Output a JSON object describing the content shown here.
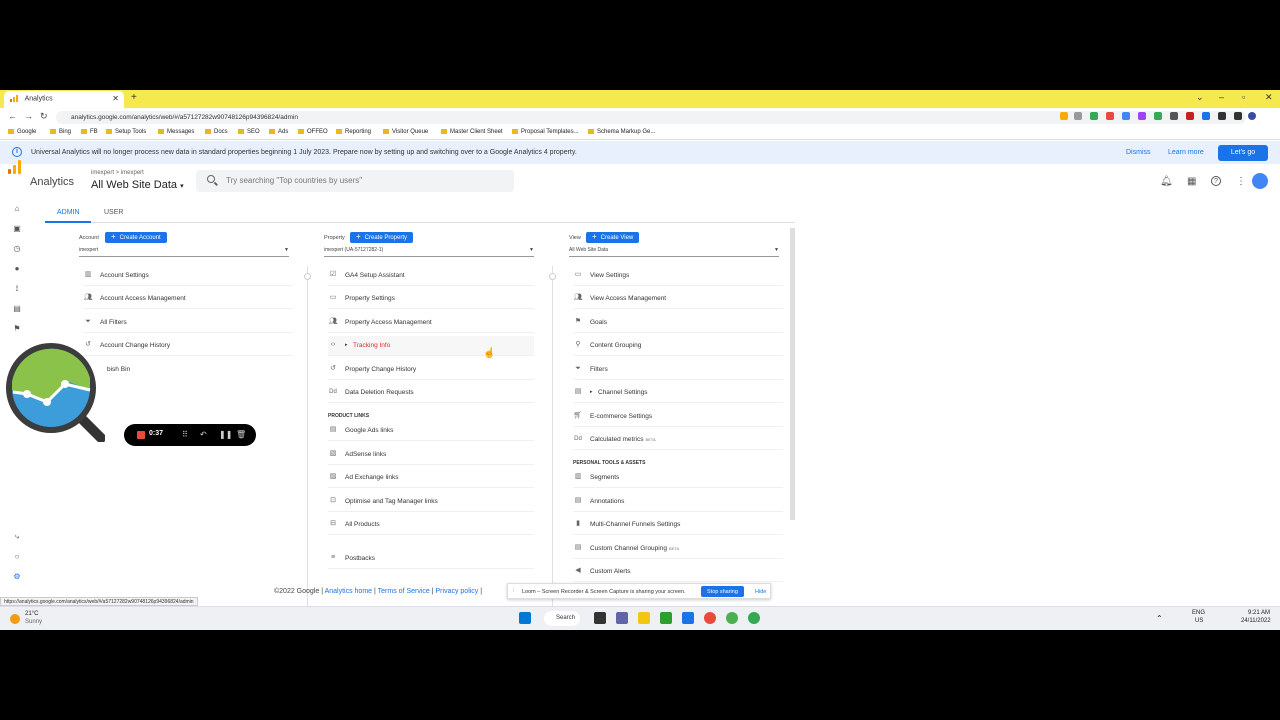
{
  "browser": {
    "tab_title": "Analytics",
    "url": "analytics.google.com/analytics/web/#/a57127282w90748126p94396824/admin",
    "bookmarks": [
      "Google",
      "Bing",
      "FB",
      "Setup Tools",
      "Messages",
      "Docs",
      "SEO",
      "Ads",
      "OFFEO",
      "Reporting",
      "Visitor Queue",
      "Master Client Sheet",
      "Proposal Templates...",
      "Schema Markup Ge..."
    ]
  },
  "banner": {
    "message": "Universal Analytics will no longer process new data in standard properties beginning 1 July 2023. Prepare now by setting up and switching over to a Google Analytics 4 property.",
    "dismiss": "Dismiss",
    "learn_more": "Learn more",
    "lets_go": "Let's go"
  },
  "header": {
    "app_title": "Analytics",
    "breadcrumb": "imexpert > imexpert",
    "property_name": "All Web Site Data",
    "search_placeholder": "Try searching \"Top countries by users\""
  },
  "admin_tabs": [
    "ADMIN",
    "USER"
  ],
  "account": {
    "label": "Account",
    "create": "Create Account",
    "selected": "imexpert",
    "items": [
      "Account Settings",
      "Account Access Management",
      "All Filters",
      "Account Change History",
      "bish Bin"
    ]
  },
  "property": {
    "label": "Property",
    "create": "Create Property",
    "selected": "imexpert (UA-57127282-1)",
    "items": [
      "GA4 Setup Assistant",
      "Property Settings",
      "Property Access Management",
      "Tracking Info",
      "Property Change History",
      "Data Deletion Requests"
    ],
    "product_links_heading": "PRODUCT LINKS",
    "product_links": [
      "Google Ads links",
      "AdSense links",
      "Ad Exchange links",
      "Optimise and Tag Manager links",
      "All Products",
      "Postbacks"
    ]
  },
  "view": {
    "label": "View",
    "create": "Create View",
    "selected": "All Web Site Data",
    "items": [
      "View Settings",
      "View Access Management",
      "Goals",
      "Content Grouping",
      "Filters",
      "Channel Settings",
      "E-commerce Settings",
      "Calculated metrics"
    ],
    "beta": "BETA",
    "personal_heading": "PERSONAL TOOLS & ASSETS",
    "personal": [
      "Segments",
      "Annotations",
      "Multi-Channel Funnels Settings",
      "Custom Channel Grouping",
      "Custom Alerts"
    ]
  },
  "footer": {
    "copyright": "©2022 Google |",
    "analytics_home": "Analytics home",
    "terms": "Terms of Service",
    "privacy": "Privacy policy",
    "sep": "|"
  },
  "status_url": "https://analytics.google.com/analytics/web/#/a57127282w90748126p94396824/admin",
  "loom": {
    "timer": "0:37",
    "share_message": "Loom – Screen Recorder & Screen Capture is sharing your screen.",
    "stop_sharing": "Stop sharing",
    "hide": "Hide"
  },
  "taskbar": {
    "weather_temp": "21°C",
    "weather_desc": "Sunny",
    "search": "Search",
    "lang": "ENG",
    "region": "US",
    "time": "9:21 AM",
    "date": "24/11/2022"
  },
  "colors": {
    "accent": "#1a73e8",
    "banner_bg": "#e8f0fe",
    "tab_bar": "#f6e84f",
    "tracking_info": "#d93025"
  }
}
